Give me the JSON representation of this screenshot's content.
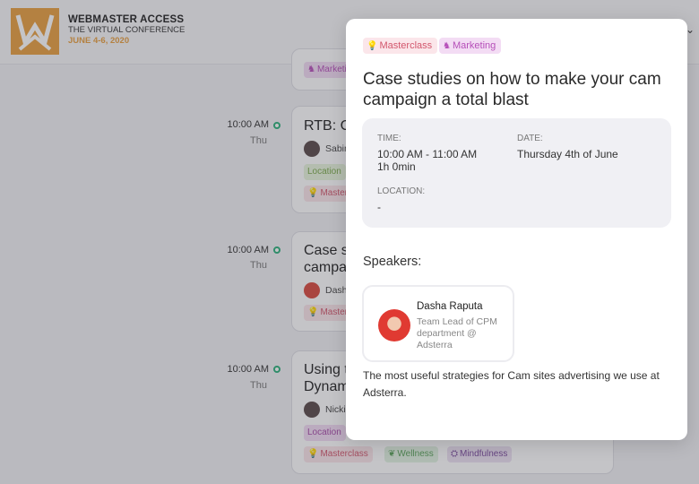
{
  "header": {
    "logo_title": "WEBMASTER ACCESS",
    "logo_subtitle": "THE VIRTUAL CONFERENCE",
    "logo_dates": "JUNE 4-6, 2020",
    "menu_chevron": "⌄"
  },
  "schedule": {
    "top_card_tag": "Marketing",
    "events": [
      {
        "time": "10:00 AM",
        "day": "Thu",
        "title_line1": "RTB: C",
        "title_line2": "",
        "speaker": "Sabin",
        "location_tag": "Location",
        "tags": [
          "Master"
        ]
      },
      {
        "time": "10:00 AM",
        "day": "Thu",
        "title_line1": "Case s",
        "title_line2": "campa",
        "speaker": "Dasha",
        "location_tag": "",
        "tags": [
          "Master"
        ]
      },
      {
        "time": "10:00 AM",
        "day": "Thu",
        "title_line1": "Using t",
        "title_line2": "Dynam",
        "speaker": "Nicki",
        "location_tag": "Location",
        "tags": [
          "Masterclass",
          "Wellness",
          "Mindfulness"
        ]
      }
    ]
  },
  "modal": {
    "tags": [
      "Masterclass",
      "Marketing"
    ],
    "title": "Case studies on how to make your cam campaign a total blast",
    "time_label": "TIME:",
    "time_value": "10:00 AM - 11:00 AM",
    "duration": "1h 0min",
    "date_label": "DATE:",
    "date_value": "Thursday 4th of June",
    "location_label": "LOCATION:",
    "location_value": "-",
    "speakers_label": "Speakers:",
    "speaker": {
      "name": "Dasha Raputa",
      "role": "Team Lead of CPM department @ Adsterra"
    },
    "description": "The most useful strategies for Cam sites advertising we use at Adsterra."
  },
  "colors": {
    "accent_orange": "#e8a040",
    "timeline_green": "#2bb07a",
    "masterclass_pink": "#d2566c",
    "marketing_purple": "#b64fb9"
  },
  "icons": [
    "lightbulb-icon",
    "unicorn-icon",
    "leaf-icon",
    "meditation-icon"
  ]
}
